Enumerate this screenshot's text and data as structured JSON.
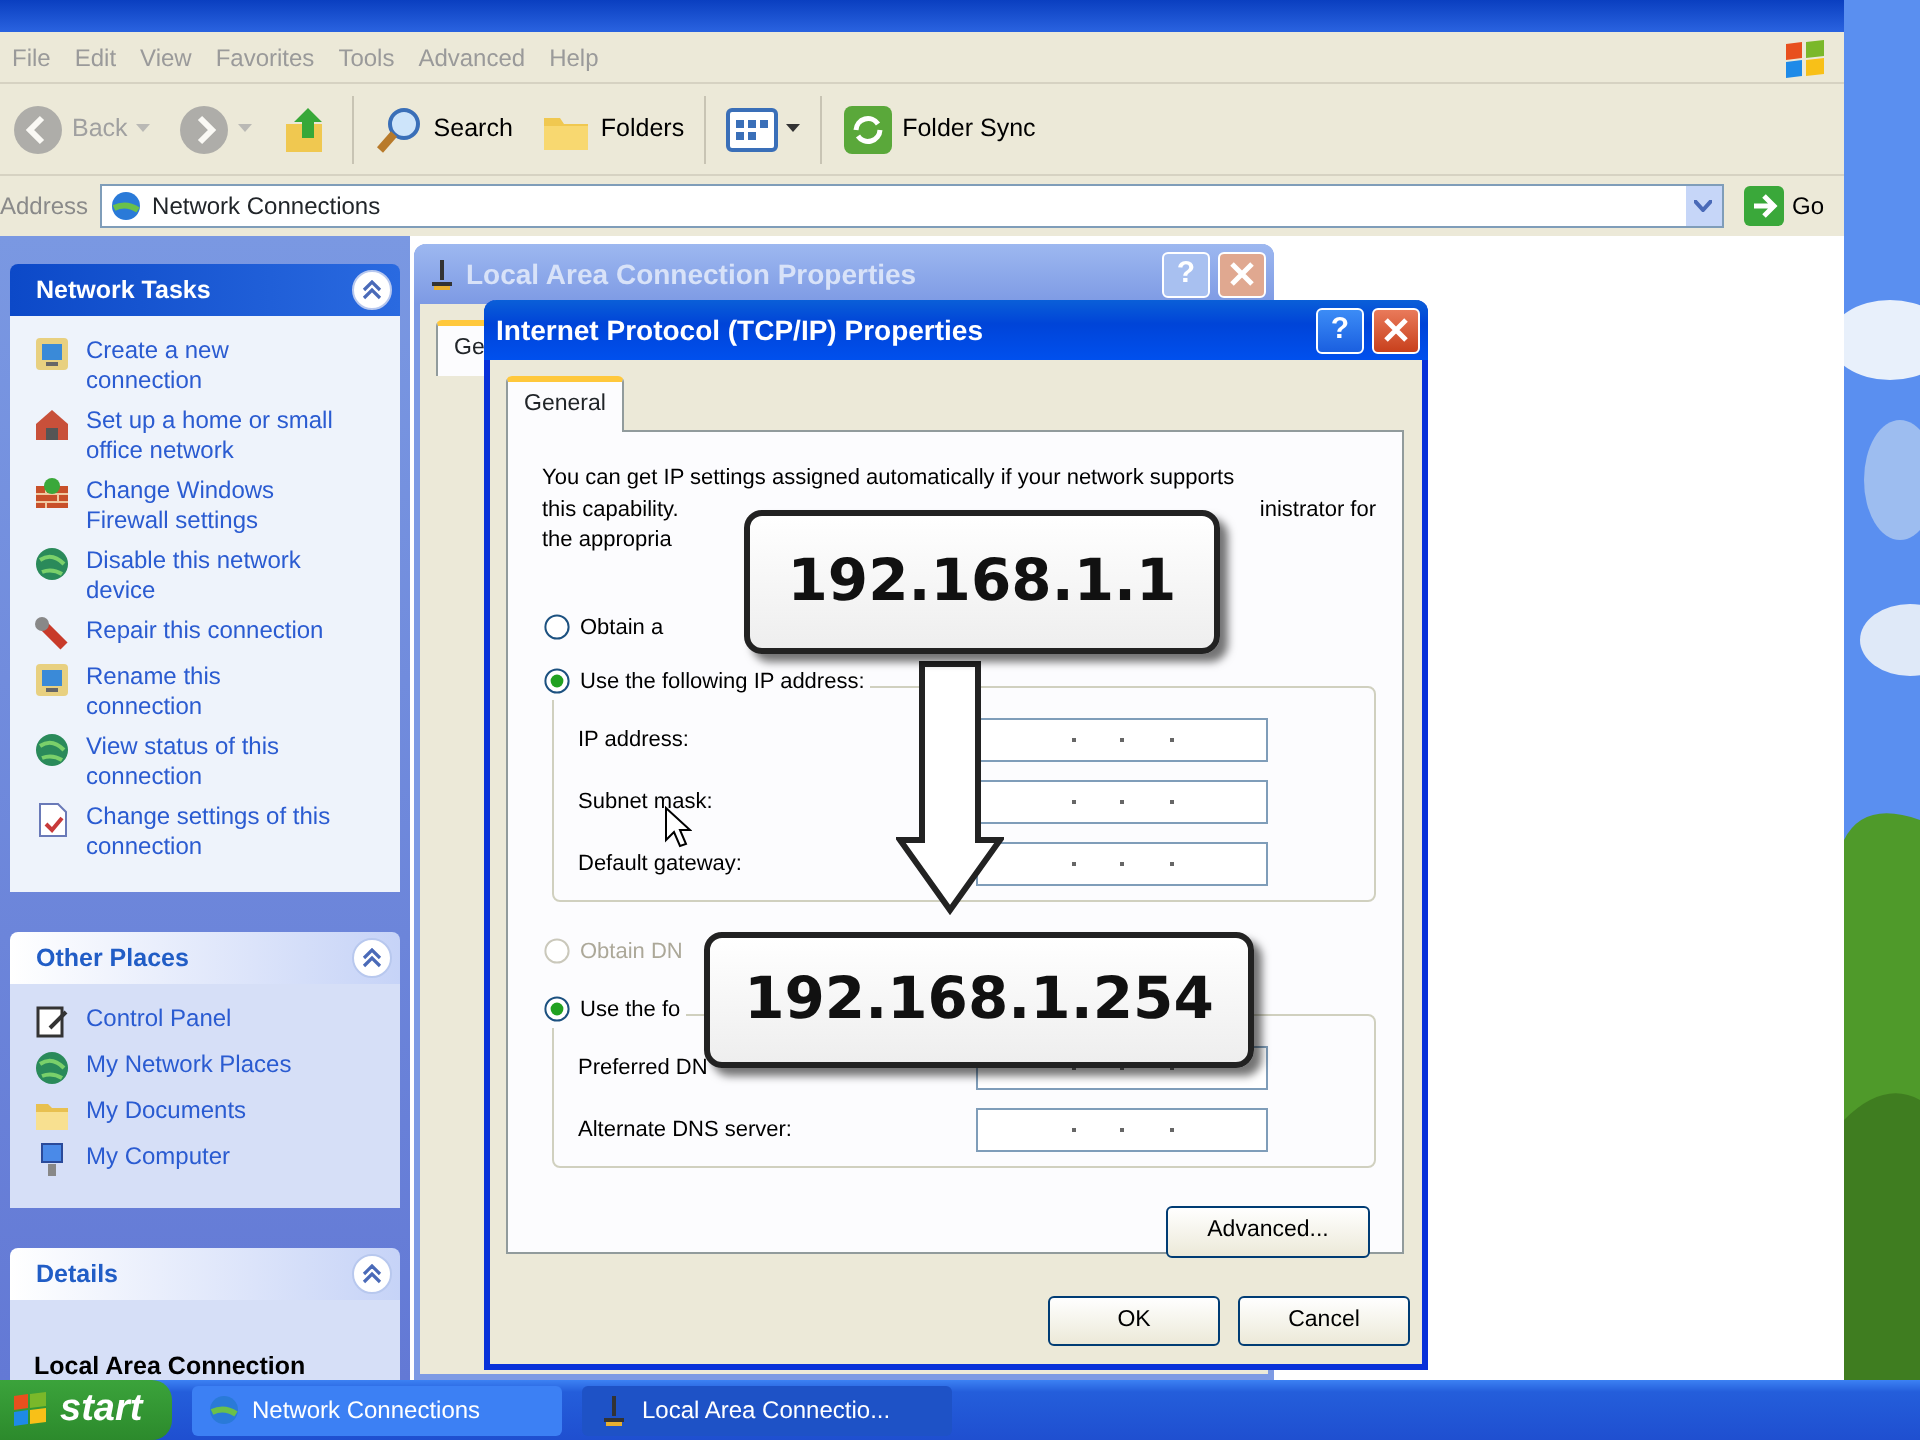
{
  "explorer": {
    "menu": [
      "File",
      "Edit",
      "View",
      "Favorites",
      "Tools",
      "Advanced",
      "Help"
    ],
    "toolbar": [
      {
        "kind": "back",
        "label": "Back",
        "disabled": true
      },
      {
        "kind": "forward",
        "disabled": true
      },
      {
        "kind": "up"
      },
      {
        "kind": "search",
        "label": "Search"
      },
      {
        "kind": "folders",
        "label": "Folders"
      },
      {
        "kind": "views"
      },
      {
        "kind": "sync",
        "label": "Folder Sync"
      }
    ],
    "address": {
      "label": "Address",
      "value": "Network Connections",
      "go": "Go"
    },
    "panels": [
      {
        "title": "Network Tasks",
        "expanded": true,
        "items": [
          {
            "kind": "monitor",
            "label": "Create a new connection"
          },
          {
            "kind": "house",
            "label": "Set up a home or small office network"
          },
          {
            "kind": "wall",
            "label": "Change Windows Firewall settings"
          },
          {
            "kind": "globe",
            "label": "Disable this network device"
          },
          {
            "kind": "wrench",
            "label": "Repair this connection"
          },
          {
            "kind": "monitor",
            "label": "Rename this connection"
          },
          {
            "kind": "globe",
            "label": "View status of this connection"
          },
          {
            "kind": "document",
            "label": "Change settings of this connection"
          }
        ]
      },
      {
        "title": "Other Places",
        "expanded": true,
        "items": [
          {
            "kind": "panel",
            "label": "Control Panel"
          },
          {
            "kind": "globe",
            "label": "My Network Places"
          },
          {
            "kind": "folder",
            "label": "My Documents"
          },
          {
            "kind": "computer",
            "label": "My Computer"
          }
        ]
      },
      {
        "title": "Details",
        "expanded": true,
        "items": [
          {
            "kind": "heading",
            "label": "Local Area Connection"
          }
        ]
      }
    ]
  },
  "back_dialog": {
    "title": "Local Area Connection Properties",
    "help": "?",
    "tabs": [
      {
        "label": "Ge",
        "selected": true
      }
    ]
  },
  "dialog": {
    "title": "Internet Protocol (TCP/IP) Properties",
    "help": "?",
    "tabs": [
      {
        "label": "General",
        "selected": true
      }
    ],
    "intro": [
      {
        "text": "You can get IP settings assigned automatically if your network supports"
      },
      {
        "text": "this capability.",
        "tail": "inistrator for"
      },
      {
        "text": "the appropria"
      }
    ],
    "ip_options": [
      {
        "label": "Obtain a",
        "selected": false,
        "disabled": false
      },
      {
        "label": "Use the following IP address:",
        "selected": true,
        "disabled": false
      }
    ],
    "ip_fields": [
      {
        "label": "IP address:"
      },
      {
        "label": "Subnet mask:"
      },
      {
        "label": "Default gateway:"
      }
    ],
    "dns_options": [
      {
        "label": "Obtain DN",
        "selected": false,
        "disabled": true
      },
      {
        "label": "Use the fo",
        "selected": true,
        "disabled": false
      }
    ],
    "dns_fields": [
      {
        "label": "Preferred DN"
      },
      {
        "label": "Alternate DNS server:"
      }
    ],
    "advanced": "Advanced...",
    "buttons": [
      "OK",
      "Cancel"
    ]
  },
  "callouts": [
    "192.168.1.1",
    "192.168.1.254"
  ],
  "taskbar": {
    "start": "start",
    "tasks": [
      {
        "label": "Network Connections",
        "selected": false
      },
      {
        "label": "Local Area Connectio...",
        "selected": true
      }
    ]
  }
}
